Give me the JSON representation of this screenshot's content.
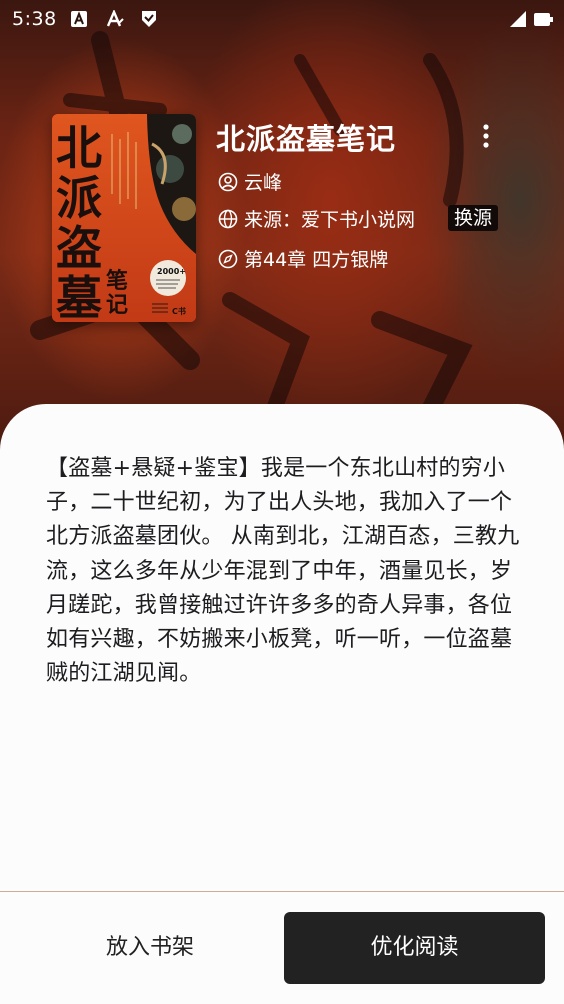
{
  "status_bar": {
    "time": "5:38",
    "icons": [
      "a-icon",
      "text-icon",
      "shield-icon",
      "signal-icon",
      "battery-icon"
    ]
  },
  "book": {
    "title": "北派盗墓笔记",
    "author": "云峰",
    "source_label": "来源：爱下书小说网",
    "swap_source": "换源",
    "chapter": "第44章 四方银牌",
    "cover": {
      "main_chars": [
        "北",
        "派",
        "盗",
        "墓"
      ],
      "sub_chars": [
        "笔",
        "记"
      ],
      "badge": "2000+",
      "publisher_mark": "C书"
    }
  },
  "intro": "【盗墓+悬疑+鉴宝】我是一个东北山村的穷小子，二十世纪初，为了出人头地，我加入了一个北方派盗墓团伙。 从南到北，江湖百态，三教九流，这么多年从少年混到了中年，酒量见长，岁月蹉跎，我曾接触过许许多多的奇人异事，各位如有兴趣，不妨搬来小板凳，听一听，一位盗墓贼的江湖见闻。",
  "actions": {
    "add_to_shelf": "放入书架",
    "optimized_read": "优化阅读"
  },
  "colors": {
    "cover_red": "#d9481c",
    "dark_button": "#222222",
    "sheet_bg": "#fcfcfd",
    "accent_line": "#cfa99a"
  }
}
